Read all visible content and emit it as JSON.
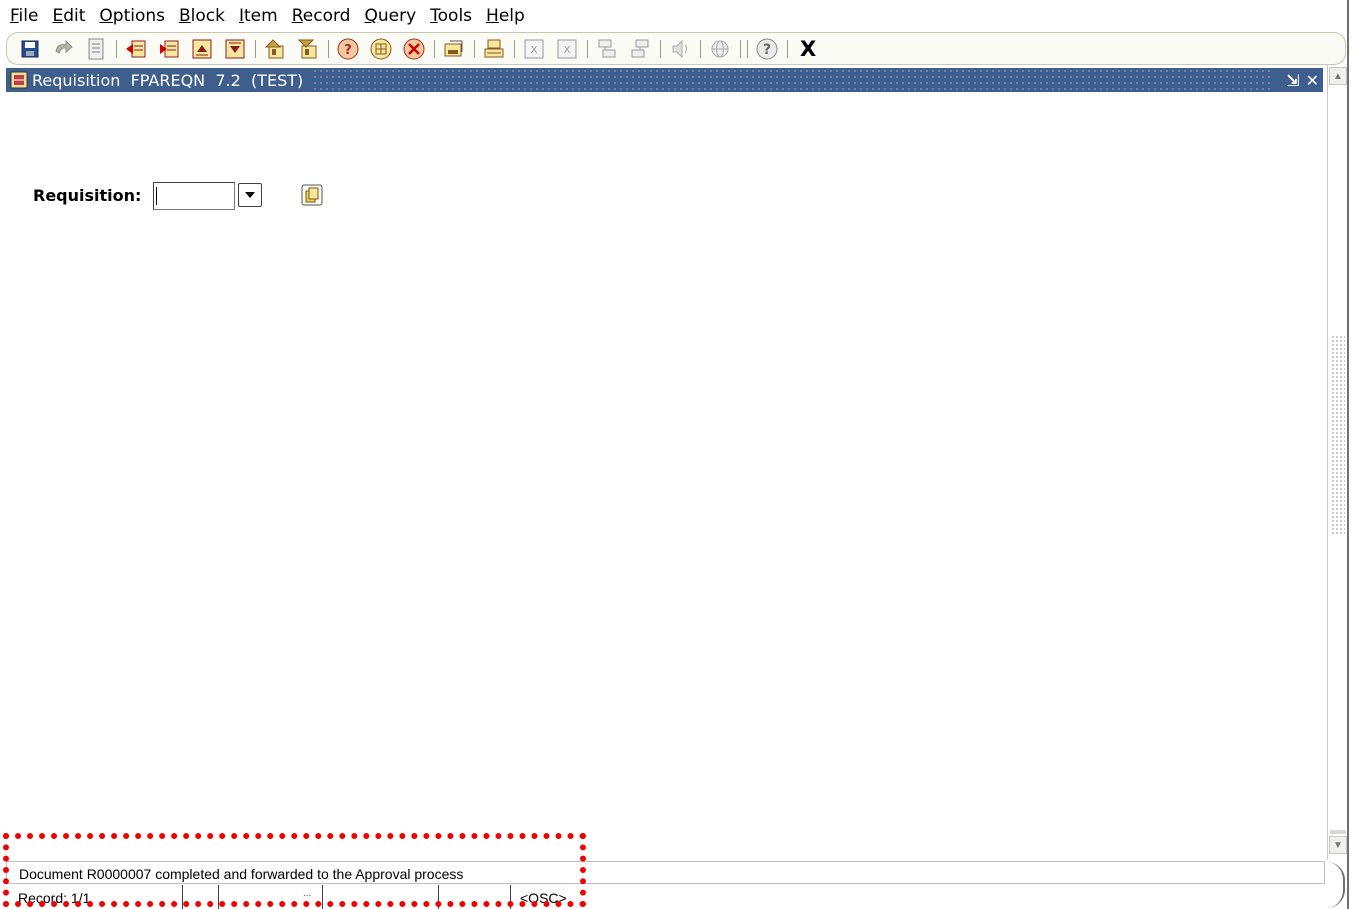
{
  "menu": [
    {
      "label": "File",
      "ul": "F",
      "rest": "ile"
    },
    {
      "label": "Edit",
      "ul": "E",
      "rest": "dit"
    },
    {
      "label": "Options",
      "ul": "O",
      "rest": "ptions"
    },
    {
      "label": "Block",
      "ul": "B",
      "rest": "lock"
    },
    {
      "label": "Item",
      "ul": "I",
      "rest": "tem"
    },
    {
      "label": "Record",
      "ul": "R",
      "rest": "ecord"
    },
    {
      "label": "Query",
      "ul": "Q",
      "rest": "uery"
    },
    {
      "label": "Tools",
      "ul": "T",
      "rest": "ools"
    },
    {
      "label": "Help",
      "ul": "H",
      "rest": "elp"
    }
  ],
  "toolbar": {
    "exit_label": "X",
    "icons": [
      "save-icon",
      "rollback-icon",
      "print-icon",
      "next-field-icon",
      "previous-field-icon",
      "next-record-icon",
      "previous-record-icon",
      "enter-query-icon",
      "execute-query-icon",
      "insert-record-icon",
      "remove-record-icon",
      "block-icon",
      "next-block-icon",
      "print-block-icon",
      "extract-icon",
      "extract-all-icon",
      "options-icon",
      "more-options-icon",
      "speaker-icon",
      "globe-icon",
      "help-icon"
    ]
  },
  "window": {
    "title": "Requisition  FPAREQN  7.2  (TEST)",
    "minimize_glyph": "⇲",
    "close_glyph": "✕"
  },
  "form": {
    "requisition_label": "Requisition:",
    "requisition_value": ""
  },
  "status": {
    "message": "Document R0000007  completed and forwarded to the Approval process",
    "record": "Record: 1/1",
    "dots": "...",
    "mode": "<OSC>"
  },
  "colors": {
    "titlebar": "#3e5f8e",
    "highlight": "#ee0000"
  }
}
